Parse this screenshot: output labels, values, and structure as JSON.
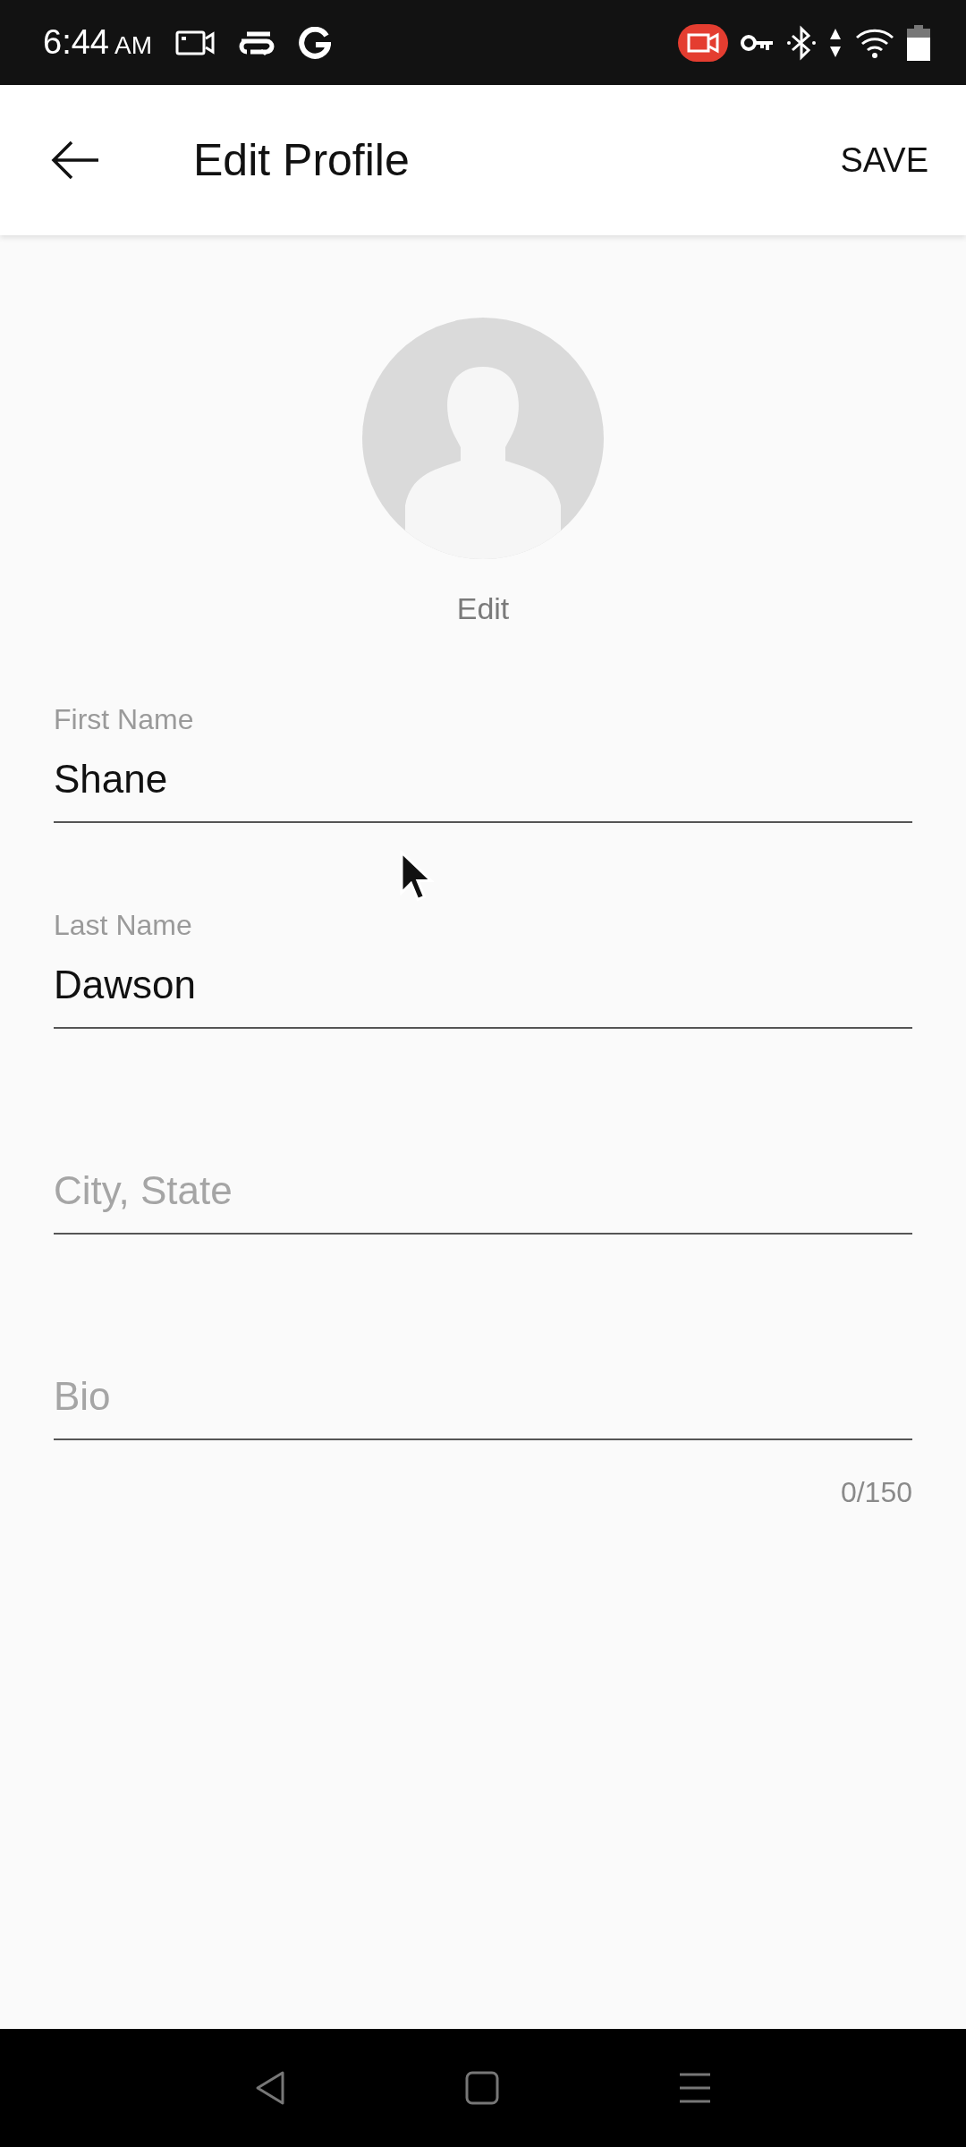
{
  "status_bar": {
    "time": "6:44",
    "period": "AM"
  },
  "app_bar": {
    "title": "Edit Profile",
    "action": "SAVE"
  },
  "avatar": {
    "edit_label": "Edit"
  },
  "fields": [
    {
      "label": "First Name",
      "value": "Shane"
    },
    {
      "label": "Last Name",
      "value": "Dawson"
    },
    {
      "placeholder": "City, State"
    },
    {
      "placeholder": "Bio",
      "counter": "0/150"
    }
  ]
}
